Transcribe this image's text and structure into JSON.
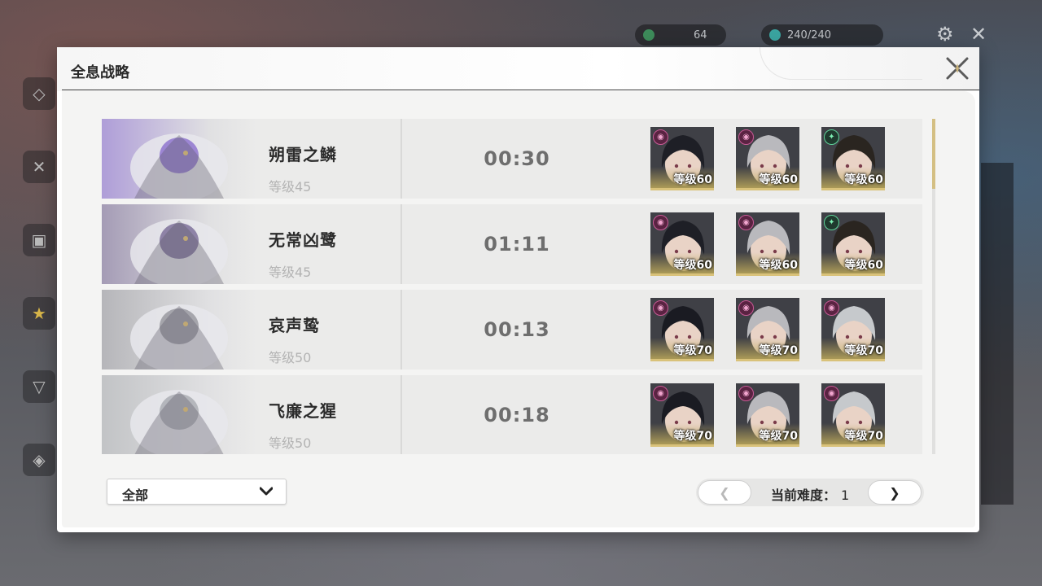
{
  "background": {
    "hud_values": [
      "64",
      "240/240"
    ]
  },
  "dialog": {
    "title": "全息战略",
    "close_icon": "close-x-icon"
  },
  "bosses": [
    {
      "name": "朔雷之鳞",
      "level": "等级45",
      "time": "00:30",
      "accent": "#7d5ec9",
      "team": [
        {
          "element": "spectro",
          "level": "等级60",
          "hair": "#1e1f26"
        },
        {
          "element": "spectro",
          "level": "等级60",
          "hair": "#b9b9bd"
        },
        {
          "element": "aero",
          "level": "等级60",
          "hair": "#2a2520"
        }
      ]
    },
    {
      "name": "无常凶鹭",
      "level": "等级45",
      "time": "01:11",
      "accent": "#6a5a8a",
      "team": [
        {
          "element": "spectro",
          "level": "等级60",
          "hair": "#1e1f26"
        },
        {
          "element": "spectro",
          "level": "等级60",
          "hair": "#b9b9bd"
        },
        {
          "element": "aero",
          "level": "等级60",
          "hair": "#2a2520"
        }
      ]
    },
    {
      "name": "哀声鸷",
      "level": "等级50",
      "time": "00:13",
      "accent": "#8a8a92",
      "team": [
        {
          "element": "spectro",
          "level": "等级70",
          "hair": "#1a1b22"
        },
        {
          "element": "spectro",
          "level": "等级70",
          "hair": "#b9b9bd"
        },
        {
          "element": "spectro",
          "level": "等级70",
          "hair": "#c6c9cc"
        }
      ]
    },
    {
      "name": "飞廉之猩",
      "level": "等级50",
      "time": "00:18",
      "accent": "#a0a3a8",
      "team": [
        {
          "element": "spectro",
          "level": "等级70",
          "hair": "#1a1b22"
        },
        {
          "element": "spectro",
          "level": "等级70",
          "hair": "#b9b9bd"
        },
        {
          "element": "spectro",
          "level": "等级70",
          "hair": "#c6c9cc"
        }
      ]
    }
  ],
  "filter": {
    "selected": "全部",
    "chevron_icon": "chevron-down-icon"
  },
  "pager": {
    "prev": "❮",
    "label": "当前难度：",
    "value": "1",
    "next": "❯"
  },
  "colors": {
    "accent_gold": "#d9c27a",
    "spectro": "#c95a96",
    "aero": "#5fd59a"
  }
}
